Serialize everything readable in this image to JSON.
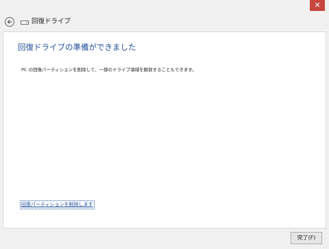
{
  "titlebar": {
    "close_glyph": "✕"
  },
  "nav": {
    "title": "回復ドライブ"
  },
  "main": {
    "heading": "回復ドライブの準備ができました",
    "description": "PC の回復パーティションを削除して、一部のドライブ領域を解放することもできます。",
    "delete_link": "回復パーティションを削除します"
  },
  "footer": {
    "finish_label": "完了(F)"
  },
  "colors": {
    "close": "#c7463e",
    "accent": "#1e4e96"
  }
}
